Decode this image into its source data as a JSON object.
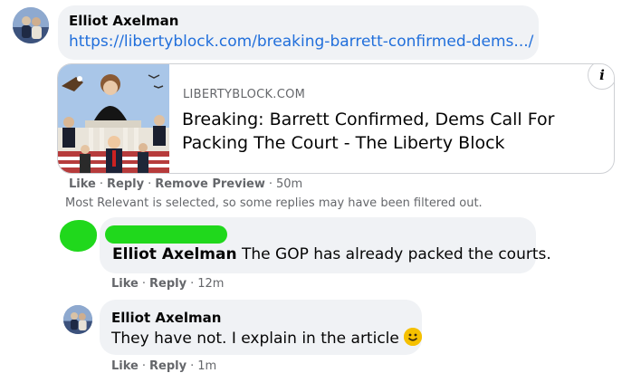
{
  "top_comment": {
    "author": "Elliot Axelman",
    "link": "https://libertyblock.com/breaking-barrett-confirmed-dems.../",
    "preview": {
      "domain": "LIBERTYBLOCK.COM",
      "title_line1": "Breaking: Barrett Confirmed, Dems Call For",
      "title_line2": "Packing The Court - The Liberty Block",
      "info_glyph": "i"
    },
    "actions": {
      "like": "Like",
      "reply": "Reply",
      "remove_preview": "Remove Preview",
      "time": "50m"
    }
  },
  "filter_notice": "Most Relevant is selected, so some replies may have been filtered out.",
  "reply_1": {
    "author": "Elliot Axelman",
    "text": "The GOP has already packed the courts.",
    "actions": {
      "like": "Like",
      "reply": "Reply",
      "time": "12m"
    },
    "redaction_color": "#20d81c"
  },
  "reply_2": {
    "author": "Elliot Axelman",
    "text": "They have not. I explain in the article",
    "emoji": "smiling-face-icon",
    "actions": {
      "like": "Like",
      "reply": "Reply",
      "time": "1m"
    }
  },
  "colors": {
    "bubble": "#f0f2f5",
    "link": "#216fdb",
    "secondary_text": "#65676b",
    "redaction": "#20d81c"
  }
}
